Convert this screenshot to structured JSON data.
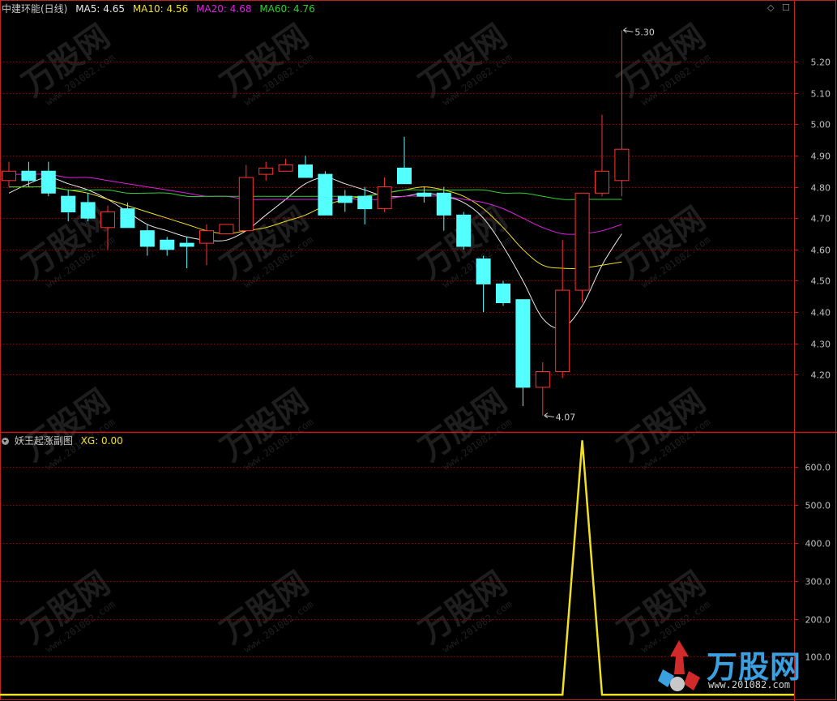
{
  "header_main": {
    "title": "中建环能(日线)",
    "ma": [
      {
        "label": "MA5: 4.65",
        "color": "#e8e8e8"
      },
      {
        "label": "MA10: 4.56",
        "color": "#f0e020"
      },
      {
        "label": "MA20: 4.68",
        "color": "#e020e0"
      },
      {
        "label": "MA60: 4.76",
        "color": "#30d030"
      }
    ]
  },
  "header_sub": {
    "title": "妖王起涨副图",
    "xg": "XG: 0.00",
    "xg_color": "#f0e020"
  },
  "controls": {
    "diamond": "◇",
    "square": "☐"
  },
  "watermark": {
    "brand": "万股网",
    "url": "www.201082.com"
  },
  "colors": {
    "up": "#ff3333",
    "down": "#54ffff",
    "grid": "#a00000",
    "axis": "#c02020",
    "label": "#c0c0c0"
  },
  "chart_data": [
    {
      "type": "candlestick",
      "yticks": [
        5.2,
        5.1,
        5.0,
        4.9,
        4.8,
        4.7,
        4.6,
        4.5,
        4.4,
        4.3,
        4.2
      ],
      "ytick_labels": [
        "5.20",
        "5.10",
        "5.00",
        "4.90",
        "4.80",
        "4.70",
        "4.60",
        "4.50",
        "4.40",
        "4.30",
        "4.20"
      ],
      "ylim": [
        4.02,
        5.35
      ],
      "candles": [
        {
          "o": 4.82,
          "c": 4.85,
          "h": 4.88,
          "l": 4.8
        },
        {
          "o": 4.85,
          "c": 4.82,
          "h": 4.88,
          "l": 4.8
        },
        {
          "o": 4.85,
          "c": 4.78,
          "h": 4.88,
          "l": 4.77
        },
        {
          "o": 4.77,
          "c": 4.72,
          "h": 4.79,
          "l": 4.69
        },
        {
          "o": 4.75,
          "c": 4.7,
          "h": 4.78,
          "l": 4.69
        },
        {
          "o": 4.67,
          "c": 4.72,
          "h": 4.74,
          "l": 4.6
        },
        {
          "o": 4.73,
          "c": 4.67,
          "h": 4.75,
          "l": 4.67
        },
        {
          "o": 4.66,
          "c": 4.61,
          "h": 4.68,
          "l": 4.58
        },
        {
          "o": 4.63,
          "c": 4.6,
          "h": 4.64,
          "l": 4.58
        },
        {
          "o": 4.62,
          "c": 4.61,
          "h": 4.64,
          "l": 4.54
        },
        {
          "o": 4.62,
          "c": 4.66,
          "h": 4.68,
          "l": 4.55
        },
        {
          "o": 4.65,
          "c": 4.68,
          "h": 4.68,
          "l": 4.65
        },
        {
          "o": 4.66,
          "c": 4.83,
          "h": 4.87,
          "l": 4.66
        },
        {
          "o": 4.84,
          "c": 4.86,
          "h": 4.88,
          "l": 4.82
        },
        {
          "o": 4.85,
          "c": 4.87,
          "h": 4.89,
          "l": 4.85
        },
        {
          "o": 4.87,
          "c": 4.83,
          "h": 4.9,
          "l": 4.83
        },
        {
          "o": 4.84,
          "c": 4.71,
          "h": 4.85,
          "l": 4.71
        },
        {
          "o": 4.77,
          "c": 4.75,
          "h": 4.79,
          "l": 4.72
        },
        {
          "o": 4.77,
          "c": 4.73,
          "h": 4.8,
          "l": 4.68
        },
        {
          "o": 4.73,
          "c": 4.8,
          "h": 4.83,
          "l": 4.72
        },
        {
          "o": 4.86,
          "c": 4.81,
          "h": 4.96,
          "l": 4.81
        },
        {
          "o": 4.78,
          "c": 4.77,
          "h": 4.8,
          "l": 4.75
        },
        {
          "o": 4.78,
          "c": 4.71,
          "h": 4.8,
          "l": 4.66
        },
        {
          "o": 4.71,
          "c": 4.61,
          "h": 4.72,
          "l": 4.6
        },
        {
          "o": 4.57,
          "c": 4.49,
          "h": 4.58,
          "l": 4.4
        },
        {
          "o": 4.49,
          "c": 4.43,
          "h": 4.5,
          "l": 4.42
        },
        {
          "o": 4.44,
          "c": 4.16,
          "h": 4.44,
          "l": 4.1
        },
        {
          "o": 4.16,
          "c": 4.21,
          "h": 4.24,
          "l": 4.07
        },
        {
          "o": 4.21,
          "c": 4.47,
          "h": 4.63,
          "l": 4.19
        },
        {
          "o": 4.47,
          "c": 4.78,
          "h": 4.78,
          "l": 4.43
        },
        {
          "o": 4.78,
          "c": 4.85,
          "h": 5.03,
          "l": 4.77
        },
        {
          "o": 4.82,
          "c": 4.92,
          "h": 5.3,
          "l": 4.77
        }
      ],
      "ma_series": [
        {
          "name": "MA5",
          "color": "#e8e8e8",
          "values": [
            4.78,
            4.81,
            4.83,
            4.81,
            4.79,
            4.76,
            4.72,
            4.68,
            4.66,
            4.64,
            4.63,
            4.63,
            4.66,
            4.71,
            4.76,
            4.81,
            4.83,
            4.81,
            4.79,
            4.77,
            4.77,
            4.78,
            4.77,
            4.75,
            4.7,
            4.61,
            4.5,
            4.38,
            4.35,
            4.42,
            4.55,
            4.65
          ]
        },
        {
          "name": "MA10",
          "color": "#f0e020",
          "values": [
            4.8,
            4.8,
            4.8,
            4.79,
            4.78,
            4.76,
            4.74,
            4.72,
            4.7,
            4.68,
            4.66,
            4.65,
            4.66,
            4.67,
            4.69,
            4.71,
            4.74,
            4.76,
            4.77,
            4.78,
            4.79,
            4.8,
            4.79,
            4.77,
            4.73,
            4.67,
            4.6,
            4.55,
            4.54,
            4.54,
            4.55,
            4.56
          ]
        },
        {
          "name": "MA20",
          "color": "#e020e0",
          "values": [
            4.84,
            4.84,
            4.84,
            4.83,
            4.83,
            4.82,
            4.81,
            4.8,
            4.79,
            4.78,
            4.77,
            4.77,
            4.76,
            4.76,
            4.76,
            4.76,
            4.76,
            4.76,
            4.76,
            4.76,
            4.77,
            4.77,
            4.77,
            4.76,
            4.75,
            4.73,
            4.7,
            4.67,
            4.65,
            4.65,
            4.66,
            4.68
          ]
        },
        {
          "name": "MA60",
          "color": "#30d030",
          "values": [
            4.8,
            4.8,
            4.8,
            4.79,
            4.79,
            4.79,
            4.78,
            4.78,
            4.78,
            4.77,
            4.77,
            4.77,
            4.77,
            4.77,
            4.77,
            4.77,
            4.77,
            4.77,
            4.77,
            4.78,
            4.79,
            4.79,
            4.79,
            4.79,
            4.79,
            4.78,
            4.78,
            4.77,
            4.76,
            4.76,
            4.76,
            4.76
          ]
        }
      ],
      "annotations": [
        {
          "label": "5.30",
          "index": 31,
          "value": 5.3
        },
        {
          "label": "4.07",
          "index": 27,
          "value": 4.07
        }
      ]
    },
    {
      "type": "line",
      "series": [
        {
          "color": "#f0e020",
          "values": [
            0,
            0,
            0,
            0,
            0,
            0,
            0,
            0,
            0,
            0,
            0,
            0,
            0,
            0,
            0,
            0,
            0,
            0,
            0,
            0,
            0,
            0,
            0,
            0,
            0,
            0,
            0,
            0,
            0,
            670,
            0,
            0
          ]
        }
      ],
      "yticks": [
        600,
        500,
        400,
        300,
        200,
        100
      ],
      "ytick_labels": [
        "600.0",
        "500.0",
        "400.0",
        "300.0",
        "200.0",
        "100.0"
      ],
      "ylim": [
        -10,
        690
      ]
    }
  ]
}
